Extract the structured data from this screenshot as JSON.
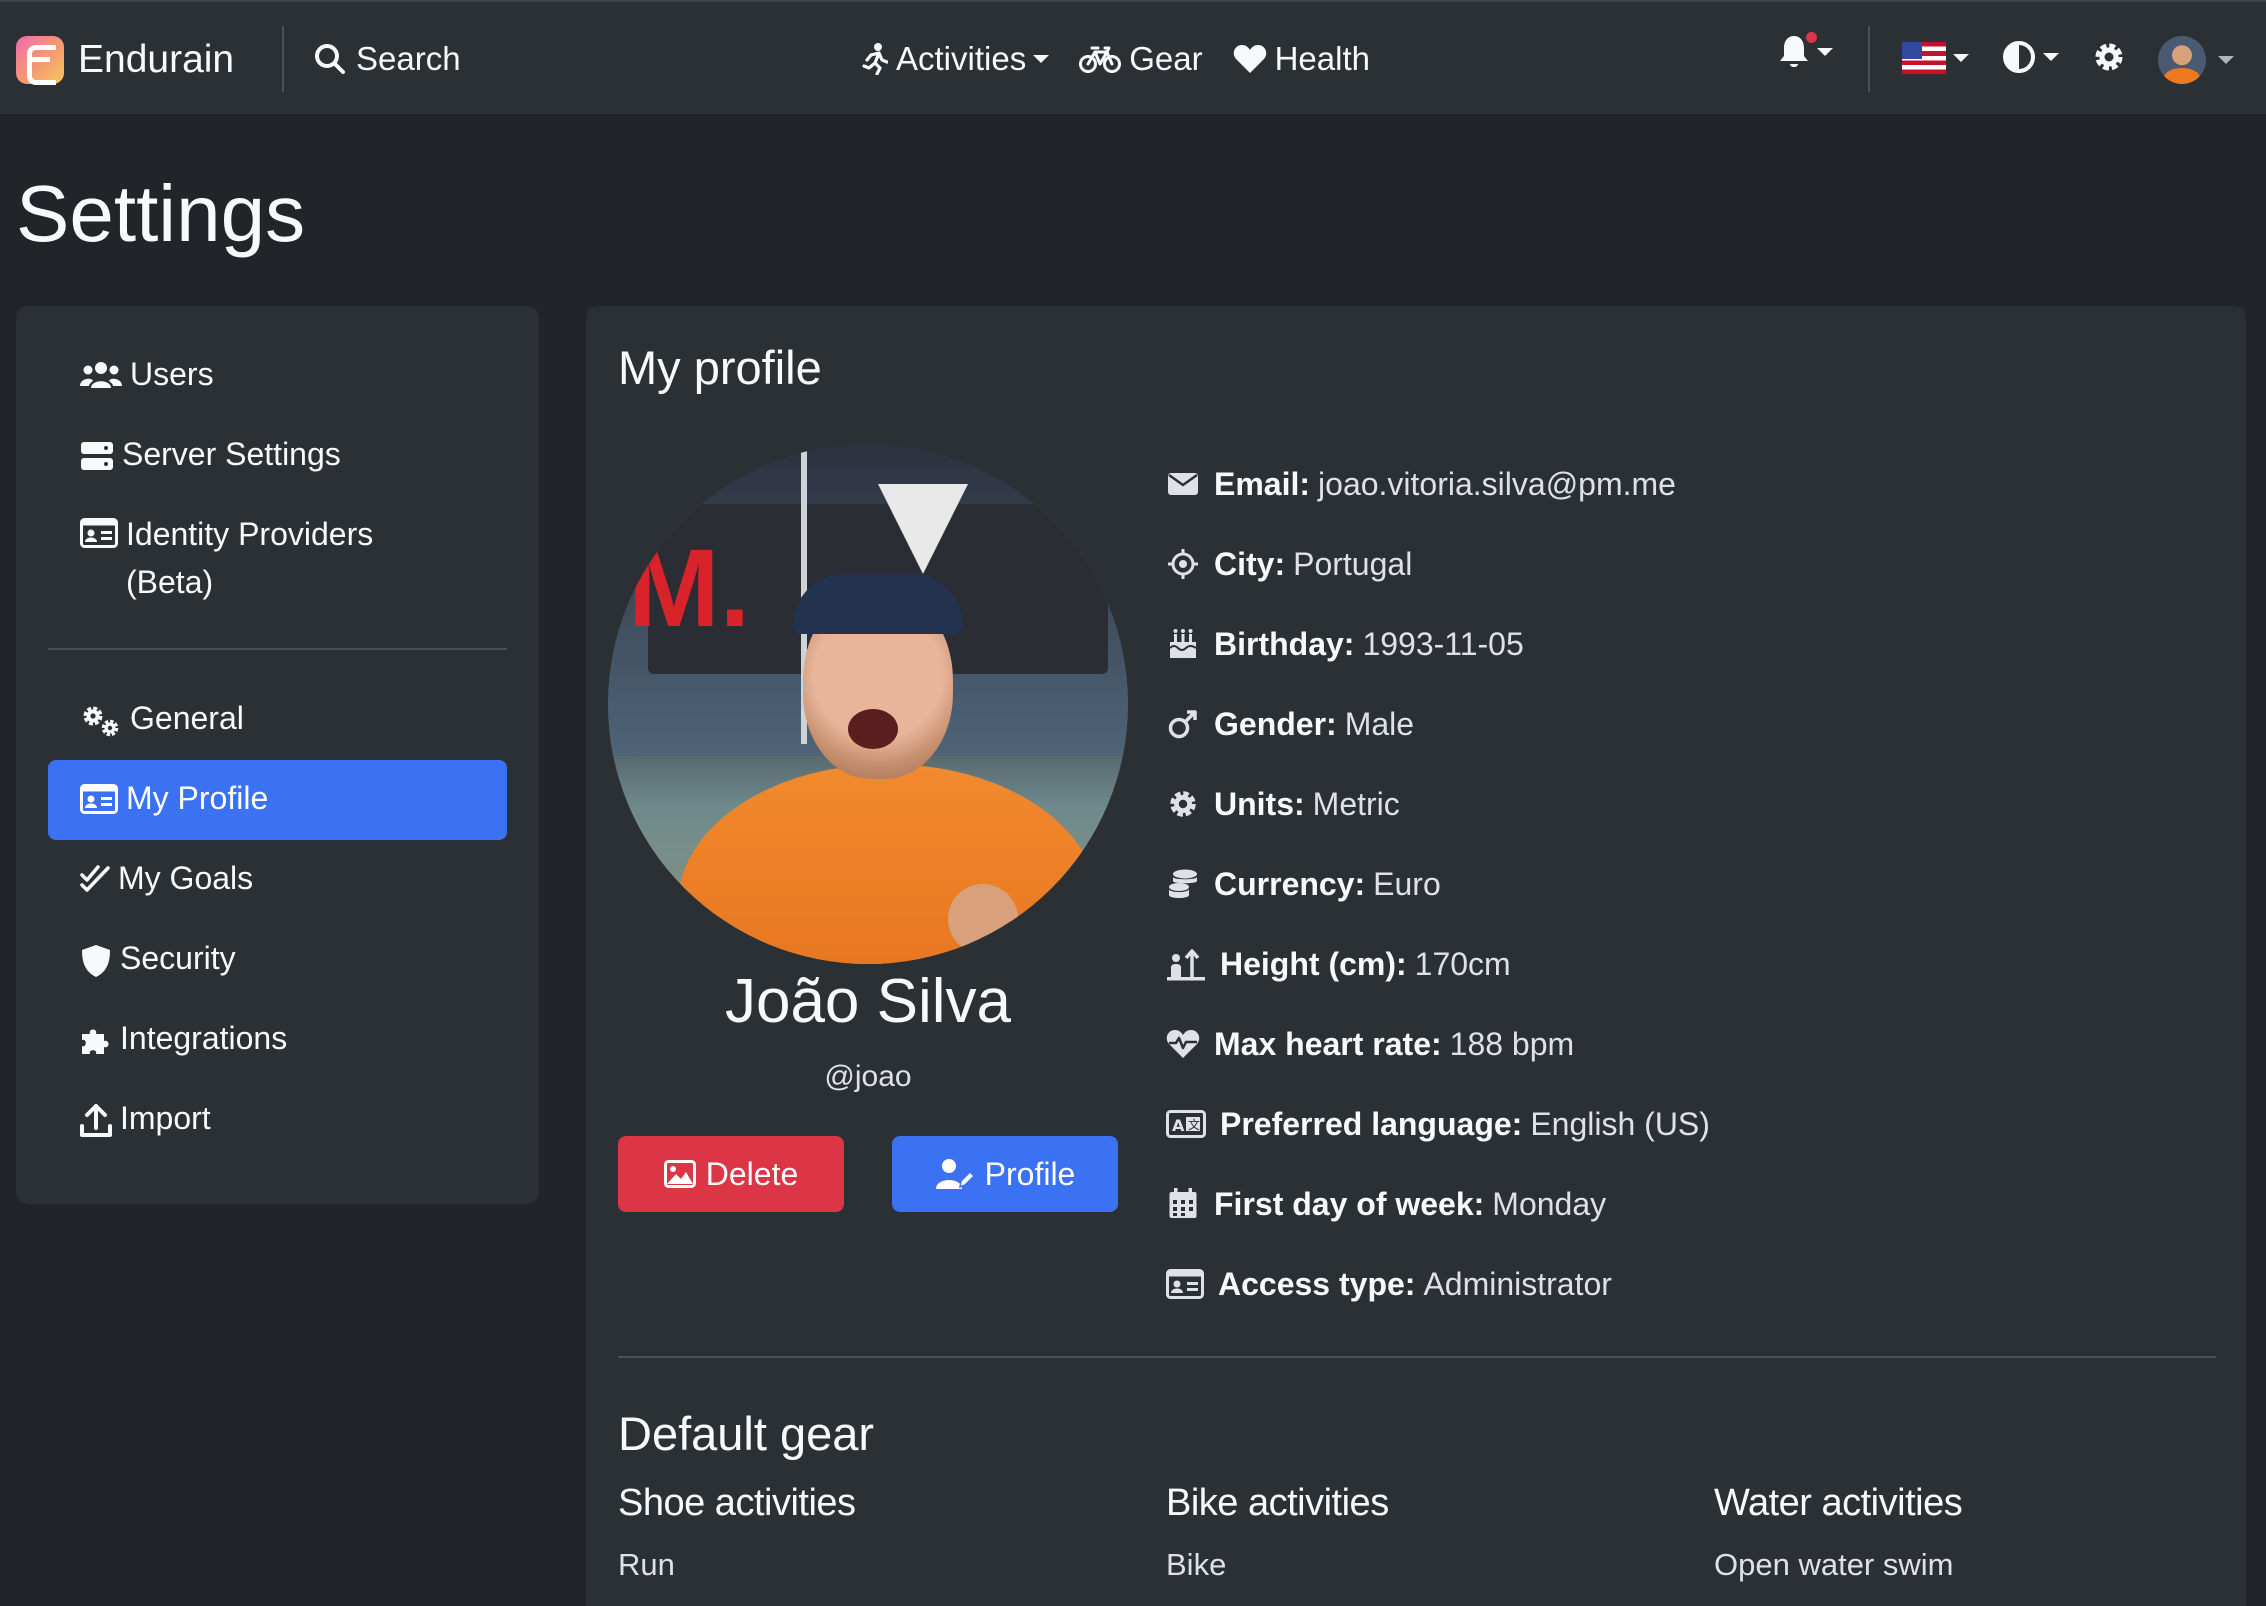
{
  "navbar": {
    "brand": "Endurain",
    "search": "Search",
    "links": {
      "activities": "Activities",
      "gear": "Gear",
      "health": "Health"
    }
  },
  "page": {
    "title": "Settings"
  },
  "sidebar": {
    "items": [
      {
        "label": "Users",
        "icon": "users-icon"
      },
      {
        "label": "Server Settings",
        "icon": "server-icon"
      },
      {
        "label": "Identity Providers (Beta)",
        "icon": "id-card-icon"
      },
      {
        "label": "General",
        "icon": "gears-icon"
      },
      {
        "label": "My Profile",
        "icon": "id-card-icon",
        "active": true
      },
      {
        "label": "My Goals",
        "icon": "check-double-icon"
      },
      {
        "label": "Security",
        "icon": "shield-icon"
      },
      {
        "label": "Integrations",
        "icon": "puzzle-icon"
      },
      {
        "label": "Import",
        "icon": "upload-icon"
      }
    ]
  },
  "profile": {
    "section_title": "My profile",
    "name": "João Silva",
    "username": "@joao",
    "delete_label": "Delete",
    "profile_label": "Profile",
    "fields": [
      {
        "label": "Email:",
        "value": "joao.vitoria.silva@pm.me",
        "icon": "envelope-icon"
      },
      {
        "label": "City:",
        "value": "Portugal",
        "icon": "location-crosshairs-icon"
      },
      {
        "label": "Birthday:",
        "value": "1993-11-05",
        "icon": "cake-icon"
      },
      {
        "label": "Gender:",
        "value": "Male",
        "icon": "mars-icon"
      },
      {
        "label": "Units:",
        "value": "Metric",
        "icon": "gear-icon"
      },
      {
        "label": "Currency:",
        "value": "Euro",
        "icon": "coins-icon"
      },
      {
        "label": "Height (cm):",
        "value": "170cm",
        "icon": "height-icon"
      },
      {
        "label": "Max heart rate:",
        "value": "188 bpm",
        "icon": "heart-pulse-icon"
      },
      {
        "label": "Preferred language:",
        "value": "English (US)",
        "icon": "language-icon"
      },
      {
        "label": "First day of week:",
        "value": "Monday",
        "icon": "calendar-icon"
      },
      {
        "label": "Access type:",
        "value": "Administrator",
        "icon": "id-card-icon"
      }
    ]
  },
  "default_gear": {
    "title": "Default gear",
    "columns": [
      {
        "heading": "Shoe activities",
        "value": "Run"
      },
      {
        "heading": "Bike activities",
        "value": "Bike"
      },
      {
        "heading": "Water activities",
        "value": "Open water swim"
      }
    ]
  },
  "colors": {
    "background": "#212529",
    "surface": "#2b3035",
    "primary": "#3b71f3",
    "danger": "#dc3545"
  }
}
